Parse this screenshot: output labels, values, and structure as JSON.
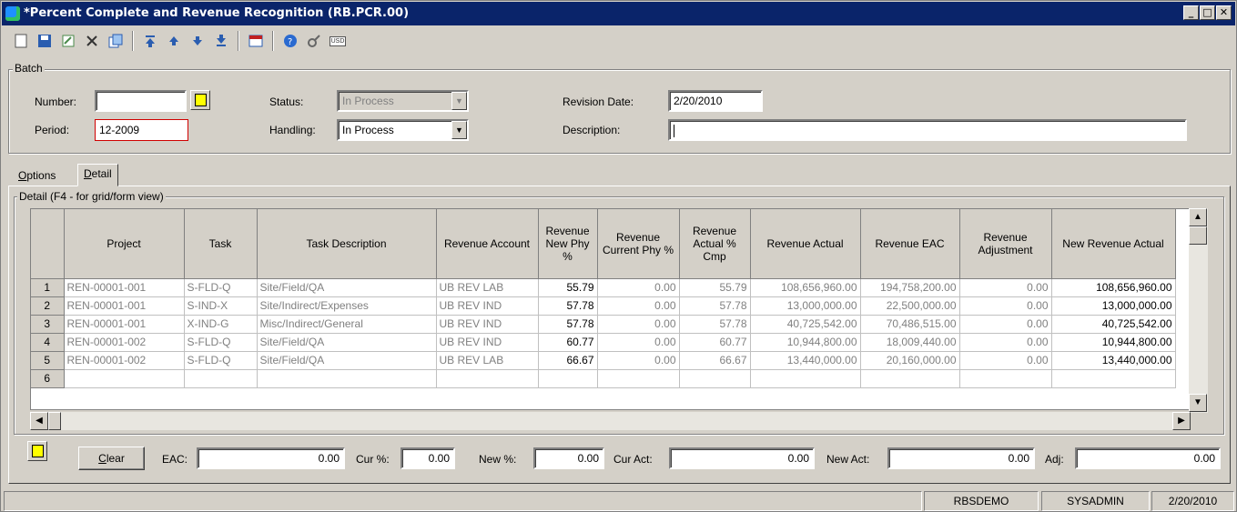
{
  "window": {
    "title": "*Percent Complete and Revenue Recognition (RB.PCR.00)",
    "buttons": [
      "_",
      "□",
      "✕"
    ]
  },
  "toolbar": {
    "icons": [
      "new-icon",
      "save-icon",
      "edit-icon",
      "delete-icon",
      "copy-icon",
      "first-icon",
      "prev-icon",
      "next-icon",
      "last-icon",
      "form-icon",
      "help-icon",
      "tools-icon",
      "currency-icon"
    ],
    "currency_label": "USD"
  },
  "batch": {
    "label": "Batch",
    "number_label": "Number:",
    "number_value": "",
    "period_label": "Period:",
    "period_value": "12-2009",
    "status_label": "Status:",
    "status_value": "In Process",
    "handling_label": "Handling:",
    "handling_value": "In Process",
    "revdate_label": "Revision Date:",
    "revdate_value": "2/20/2010",
    "desc_label": "Description:",
    "desc_value": ""
  },
  "tabs": [
    {
      "label": "Options",
      "accel": "O"
    },
    {
      "label": "Detail",
      "accel": "D"
    }
  ],
  "detail": {
    "label": "Detail (F4 - for grid/form view)"
  },
  "grid": {
    "columns": [
      "Project",
      "Task",
      "Task Description",
      "Revenue Account",
      "Revenue New Phy %",
      "Revenue Current Phy %",
      "Revenue Actual % Cmp",
      "Revenue Actual",
      "Revenue EAC",
      "Revenue Adjustment",
      "New Revenue Actual"
    ],
    "rows": [
      {
        "n": "1",
        "project": "REN-00001-001",
        "task": "S-FLD-Q",
        "desc": "Site/Field/QA",
        "acct": "UB REV LAB",
        "newphy": "55.79",
        "curphy": "0.00",
        "actcmp": "55.79",
        "actual": "108,656,960.00",
        "eac": "194,758,200.00",
        "adj": "0.00",
        "newact": "108,656,960.00"
      },
      {
        "n": "2",
        "project": "REN-00001-001",
        "task": "S-IND-X",
        "desc": "Site/Indirect/Expenses",
        "acct": "UB REV IND",
        "newphy": "57.78",
        "curphy": "0.00",
        "actcmp": "57.78",
        "actual": "13,000,000.00",
        "eac": "22,500,000.00",
        "adj": "0.00",
        "newact": "13,000,000.00"
      },
      {
        "n": "3",
        "project": "REN-00001-001",
        "task": "X-IND-G",
        "desc": "Misc/Indirect/General",
        "acct": "UB REV IND",
        "newphy": "57.78",
        "curphy": "0.00",
        "actcmp": "57.78",
        "actual": "40,725,542.00",
        "eac": "70,486,515.00",
        "adj": "0.00",
        "newact": "40,725,542.00"
      },
      {
        "n": "4",
        "project": "REN-00001-002",
        "task": "S-FLD-Q",
        "desc": "Site/Field/QA",
        "acct": "UB REV IND",
        "newphy": "60.77",
        "curphy": "0.00",
        "actcmp": "60.77",
        "actual": "10,944,800.00",
        "eac": "18,009,440.00",
        "adj": "0.00",
        "newact": "10,944,800.00"
      },
      {
        "n": "5",
        "project": "REN-00001-002",
        "task": "S-FLD-Q",
        "desc": "Site/Field/QA",
        "acct": "UB REV LAB",
        "newphy": "66.67",
        "curphy": "0.00",
        "actcmp": "66.67",
        "actual": "13,440,000.00",
        "eac": "20,160,000.00",
        "adj": "0.00",
        "newact": "13,440,000.00"
      },
      {
        "n": "6",
        "project": "",
        "task": "",
        "desc": "",
        "acct": "",
        "newphy": "",
        "curphy": "",
        "actcmp": "",
        "actual": "",
        "eac": "",
        "adj": "",
        "newact": ""
      }
    ]
  },
  "bottom": {
    "clear_label": "Clear",
    "eac_label": "EAC:",
    "eac_value": "0.00",
    "cur_label": "Cur %:",
    "cur_value": "0.00",
    "new_label": "New %:",
    "new_value": "0.00",
    "curact_label": "Cur Act:",
    "curact_value": "0.00",
    "newact_label": "New Act:",
    "newact_value": "0.00",
    "adj_label": "Adj:",
    "adj_value": "0.00"
  },
  "statusbar": {
    "db": "RBSDEMO",
    "user": "SYSADMIN",
    "date": "2/20/2010"
  }
}
